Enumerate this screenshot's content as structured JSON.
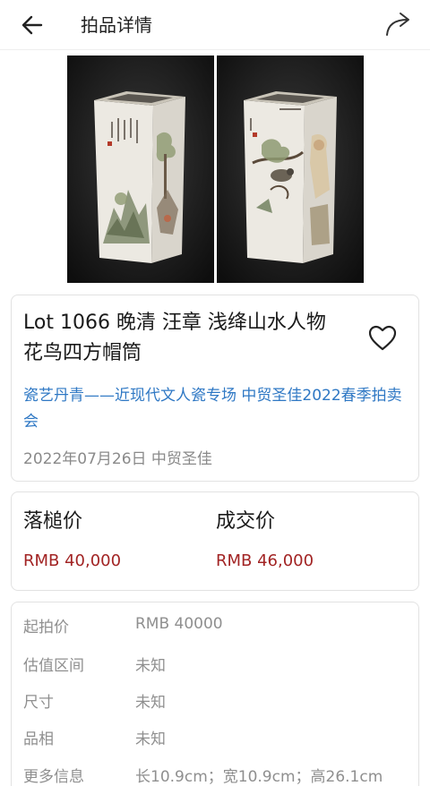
{
  "header": {
    "title": "拍品详情",
    "back_icon": "arrow-left-icon",
    "share_icon": "share-forward-icon"
  },
  "gallery": {
    "images": [
      {
        "name": "vase-front-photo",
        "description_icon": "porcelain-vase-landscape"
      },
      {
        "name": "vase-back-photo",
        "description_icon": "porcelain-vase-bird"
      }
    ]
  },
  "lot": {
    "title_line1": "Lot 1066 晚清 汪章 浅绛山水人物",
    "title_line2": "花鸟四方帽筒",
    "sale_name": "瓷艺丹青——近现代文人瓷专场 中贸圣佳2022春季拍卖会",
    "date_house": "2022年07月26日 中贸圣佳"
  },
  "prices": {
    "hammer_label": "落槌价",
    "hammer_value": "RMB 40,000",
    "deal_label": "成交价",
    "deal_value": "RMB 46,000"
  },
  "details": [
    {
      "key": "起拍价",
      "value": "RMB 40000"
    },
    {
      "key": "估值区间",
      "value": "未知"
    },
    {
      "key": "尺寸",
      "value": "未知"
    },
    {
      "key": "品相",
      "value": "未知"
    },
    {
      "key": "更多信息",
      "value": "长10.9cm；宽10.9cm；高26.1cm"
    }
  ],
  "colors": {
    "link": "#2f78c4",
    "price": "#a22424",
    "muted": "#8f8f8f"
  }
}
